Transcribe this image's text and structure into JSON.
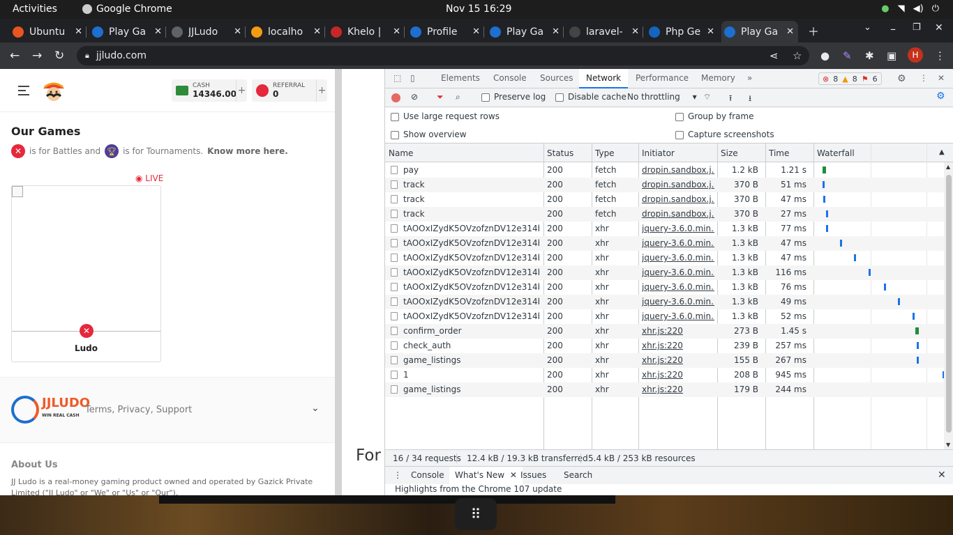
{
  "topbar": {
    "activities": "Activities",
    "app": "Google Chrome",
    "clock": "Nov 15  16:29"
  },
  "tabs": [
    {
      "label": "Ubuntu",
      "color": "#e95420"
    },
    {
      "label": "Play Ga",
      "color": "#1d6fd0"
    },
    {
      "label": "JJLudo",
      "color": "#5f6368"
    },
    {
      "label": "localho",
      "color": "#f39c12"
    },
    {
      "label": "Khelo |",
      "color": "#c62828"
    },
    {
      "label": "Profile",
      "color": "#1d6fd0"
    },
    {
      "label": "Play Ga",
      "color": "#1d6fd0"
    },
    {
      "label": "laravel-",
      "color": "#444"
    },
    {
      "label": "Php Ge",
      "color": "#1565c0"
    },
    {
      "label": "Play Ga",
      "color": "#1d6fd0"
    }
  ],
  "address": {
    "url": "jjludo.com",
    "avatar": "H"
  },
  "site": {
    "cash_label": "CASH",
    "cash_value": "14346.00",
    "referral_label": "REFERRAL",
    "referral_value": "0",
    "games_title": "Our Games",
    "legend_battles": "is for Battles and",
    "legend_tournaments": "is for Tournaments.",
    "know_more": "Know more here.",
    "live": "◉ LIVE",
    "game_name": "Ludo",
    "brand": "JJLUDO",
    "brand_tag": "WIN REAL CASH",
    "footer_links": "Terms, Privacy, Support",
    "about_title": "About Us",
    "about_text": "JJ Ludo is a real-money gaming product owned and operated by Gazick Private Limited (\"JJ Ludo\" or \"We\" or \"Us\" or \"Our\")."
  },
  "blank": {
    "text": "For"
  },
  "devtools": {
    "tabs": [
      "Elements",
      "Console",
      "Sources",
      "Network",
      "Performance",
      "Memory"
    ],
    "more": "»",
    "errors": "8",
    "warnings": "8",
    "issues": "6",
    "toolbar": {
      "preserve_log": "Preserve log",
      "disable_cache": "Disable cache",
      "throttling": "No throttling"
    },
    "options": {
      "large_rows": "Use large request rows",
      "show_overview": "Show overview",
      "group_by_frame": "Group by frame",
      "capture_screenshots": "Capture screenshots"
    },
    "columns": [
      "Name",
      "Status",
      "Type",
      "Initiator",
      "Size",
      "Time",
      "Waterfall"
    ],
    "rows": [
      {
        "name": "pay",
        "status": "200",
        "type": "fetch",
        "initiator": "dropin.sandbox.j...",
        "size": "1.2 kB",
        "time": "1.21 s",
        "wf": 0.02
      },
      {
        "name": "track",
        "status": "200",
        "type": "fetch",
        "initiator": "dropin.sandbox.j...",
        "size": "370 B",
        "time": "51 ms",
        "wf": 0.02
      },
      {
        "name": "track",
        "status": "200",
        "type": "fetch",
        "initiator": "dropin.sandbox.j...",
        "size": "370 B",
        "time": "47 ms",
        "wf": 0.03
      },
      {
        "name": "track",
        "status": "200",
        "type": "fetch",
        "initiator": "dropin.sandbox.j...",
        "size": "370 B",
        "time": "27 ms",
        "wf": 0.05
      },
      {
        "name": "tAOOxIZydK5OVzofznDV12e314b...",
        "status": "200",
        "type": "xhr",
        "initiator": "jquery-3.6.0.min....",
        "size": "1.3 kB",
        "time": "77 ms",
        "wf": 0.05
      },
      {
        "name": "tAOOxIZydK5OVzofznDV12e314b...",
        "status": "200",
        "type": "xhr",
        "initiator": "jquery-3.6.0.min....",
        "size": "1.3 kB",
        "time": "47 ms",
        "wf": 0.16
      },
      {
        "name": "tAOOxIZydK5OVzofznDV12e314b...",
        "status": "200",
        "type": "xhr",
        "initiator": "jquery-3.6.0.min....",
        "size": "1.3 kB",
        "time": "47 ms",
        "wf": 0.27
      },
      {
        "name": "tAOOxIZydK5OVzofznDV12e314b...",
        "status": "200",
        "type": "xhr",
        "initiator": "jquery-3.6.0.min....",
        "size": "1.3 kB",
        "time": "116 ms",
        "wf": 0.39
      },
      {
        "name": "tAOOxIZydK5OVzofznDV12e314b...",
        "status": "200",
        "type": "xhr",
        "initiator": "jquery-3.6.0.min....",
        "size": "1.3 kB",
        "time": "76 ms",
        "wf": 0.51
      },
      {
        "name": "tAOOxIZydK5OVzofznDV12e314b...",
        "status": "200",
        "type": "xhr",
        "initiator": "jquery-3.6.0.min....",
        "size": "1.3 kB",
        "time": "49 ms",
        "wf": 0.62
      },
      {
        "name": "tAOOxIZydK5OVzofznDV12e314b...",
        "status": "200",
        "type": "xhr",
        "initiator": "jquery-3.6.0.min....",
        "size": "1.3 kB",
        "time": "52 ms",
        "wf": 0.74
      },
      {
        "name": "confirm_order",
        "status": "200",
        "type": "xhr",
        "initiator": "xhr.js:220",
        "size": "273 B",
        "time": "1.45 s",
        "wf": 0.76
      },
      {
        "name": "check_auth",
        "status": "200",
        "type": "xhr",
        "initiator": "xhr.js:220",
        "size": "239 B",
        "time": "257 ms",
        "wf": 0.77
      },
      {
        "name": "game_listings",
        "status": "200",
        "type": "xhr",
        "initiator": "xhr.js:220",
        "size": "155 B",
        "time": "267 ms",
        "wf": 0.77
      },
      {
        "name": "1",
        "status": "200",
        "type": "xhr",
        "initiator": "xhr.js:220",
        "size": "208 B",
        "time": "945 ms",
        "wf": 0.98
      },
      {
        "name": "game_listings",
        "status": "200",
        "type": "xhr",
        "initiator": "xhr.js:220",
        "size": "179 B",
        "time": "244 ms",
        "wf": 0.99
      }
    ],
    "summary": {
      "requests": "16 / 34 requests",
      "transferred": "12.4 kB / 19.3 kB transferred",
      "resources": "5.4 kB / 253 kB resources"
    },
    "drawer_tabs": [
      "Console",
      "What's New",
      "Issues",
      "Search"
    ],
    "drawer_text": "Highlights from the Chrome 107 update"
  }
}
